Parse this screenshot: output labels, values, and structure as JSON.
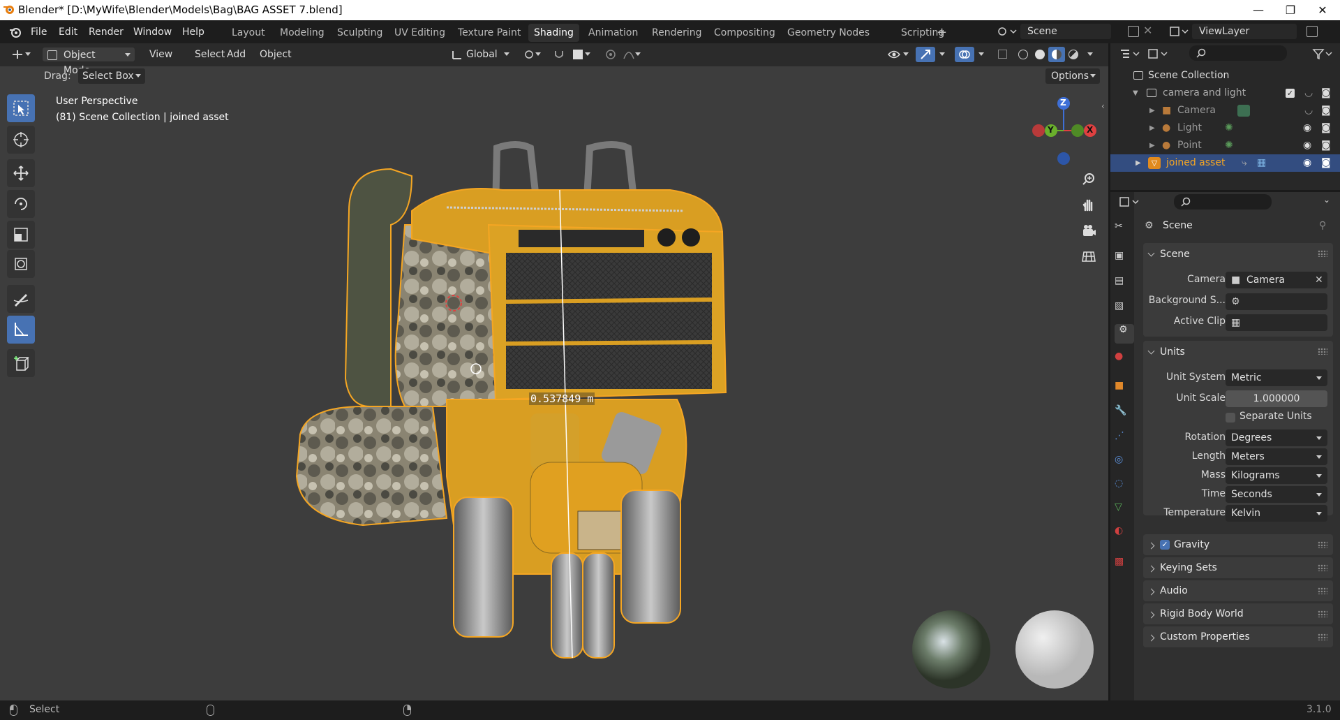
{
  "window": {
    "title": "Blender* [D:\\MyWife\\Blender\\Models\\Bag\\BAG ASSET 7.blend]",
    "controls": {
      "minimize": "—",
      "maximize": "❐",
      "close": "✕"
    }
  },
  "menus": [
    "File",
    "Edit",
    "Render",
    "Window",
    "Help"
  ],
  "workspaces": [
    "Layout",
    "Modeling",
    "Sculpting",
    "UV Editing",
    "Texture Paint",
    "Shading",
    "Animation",
    "Rendering",
    "Compositing",
    "Geometry Nodes",
    "Scripting"
  ],
  "active_workspace": "Shading",
  "add_workspace": "+",
  "scene_selector": {
    "value": "Scene"
  },
  "viewlayer_selector": {
    "value": "ViewLayer"
  },
  "viewport_header": {
    "mode": "Object Mode",
    "menus": [
      "View",
      "Select",
      "Add",
      "Object"
    ],
    "transform_orientation": "Global",
    "options": "Options"
  },
  "tool_settings": {
    "drag_label": "Drag:",
    "drag_value": "Select Box"
  },
  "viewport_overlay": {
    "perspective": "User Perspective",
    "context": "(81) Scene Collection | joined asset",
    "measurement": "0.537849 m"
  },
  "navigation_gizmo": {
    "z": "Z",
    "y": "Y",
    "x": "X"
  },
  "outliner": {
    "root": "Scene Collection",
    "rows": [
      {
        "label": "camera and light",
        "type": "collection"
      },
      {
        "label": "Camera",
        "type": "camera"
      },
      {
        "label": "Light",
        "type": "light"
      },
      {
        "label": "Point",
        "type": "light"
      },
      {
        "label": "joined asset",
        "type": "mesh",
        "selected": true
      }
    ]
  },
  "properties": {
    "context_title": "Scene",
    "panels": {
      "scene": {
        "title": "Scene",
        "camera_label": "Camera",
        "camera_value": "Camera",
        "background_label": "Background S...",
        "active_clip_label": "Active Clip"
      },
      "units": {
        "title": "Units",
        "unit_system_label": "Unit System",
        "unit_system": "Metric",
        "unit_scale_label": "Unit Scale",
        "unit_scale": "1.000000",
        "separate_units_label": "Separate Units",
        "rotation_label": "Rotation",
        "rotation": "Degrees",
        "length_label": "Length",
        "length": "Meters",
        "mass_label": "Mass",
        "mass": "Kilograms",
        "time_label": "Time",
        "time": "Seconds",
        "temperature_label": "Temperature",
        "temperature": "Kelvin"
      },
      "collapsed": [
        "Gravity",
        "Keying Sets",
        "Audio",
        "Rigid Body World",
        "Custom Properties"
      ]
    }
  },
  "statusbar": {
    "select": "Select",
    "version": "3.1.0"
  },
  "colors": {
    "accent": "#4772b3",
    "selection_outline": "#f5a623",
    "bag_yellow": "#e0a020"
  }
}
